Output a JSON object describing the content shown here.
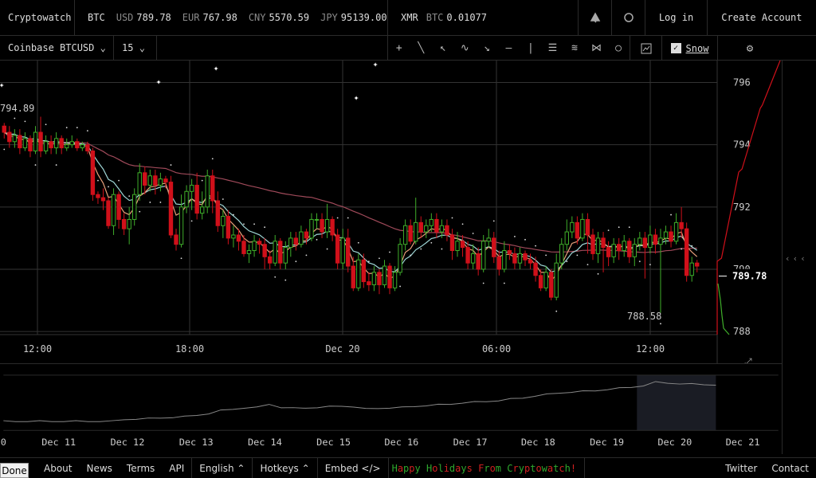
{
  "header": {
    "brand": "Cryptowatch",
    "quotes": [
      {
        "sym": "BTC",
        "pairs": [
          {
            "cur": "USD",
            "val": "789.78"
          },
          {
            "cur": "EUR",
            "val": "767.98"
          },
          {
            "cur": "CNY",
            "val": "5570.59"
          },
          {
            "cur": "JPY",
            "val": "95139.00"
          }
        ]
      }
    ],
    "xmr": {
      "sym": "XMR",
      "cur": "BTC",
      "val": "0.01077"
    },
    "alerts_icon": "alarm-icon",
    "theme_icon": "circle-icon",
    "login": "Log in",
    "create_account": "Create Account"
  },
  "toolbar": {
    "market": "Coinbase BTCUSD",
    "period": "15",
    "tools": [
      "+",
      "╲",
      "↖",
      "∿",
      "↘",
      "—",
      "|",
      "☰",
      "≋",
      "⋈",
      "○"
    ],
    "snow_label": "Snow",
    "snow_checked": true,
    "settings_icon": "gear-icon"
  },
  "chart_data": {
    "type": "candlestick",
    "market": "Coinbase BTCUSD",
    "interval": "15",
    "y_ticks": [
      788,
      790,
      792,
      794,
      796
    ],
    "ylim": [
      787.9,
      796.5
    ],
    "current_price": "789.78",
    "high_label": "794.89",
    "low_label": "788.58",
    "x_ticks": [
      "12:00",
      "18:00",
      "Dec 20",
      "06:00",
      "12:00"
    ],
    "candles": [
      [
        794.6,
        794.4,
        794.7,
        794.2
      ],
      [
        794.4,
        794.1,
        794.6,
        793.9
      ],
      [
        794.1,
        794.3,
        794.5,
        793.9
      ],
      [
        794.3,
        793.9,
        794.5,
        793.7
      ],
      [
        793.9,
        794.2,
        794.4,
        793.8
      ],
      [
        794.2,
        793.8,
        794.3,
        793.6
      ],
      [
        793.8,
        794.4,
        794.6,
        793.7
      ],
      [
        794.4,
        793.8,
        794.9,
        793.6
      ],
      [
        793.8,
        794.1,
        794.3,
        793.7
      ],
      [
        794.1,
        793.9,
        794.3,
        793.7
      ],
      [
        793.9,
        794.2,
        794.4,
        793.7
      ],
      [
        794.2,
        793.9,
        794.3,
        793.7
      ],
      [
        793.9,
        794.0,
        794.2,
        793.8
      ],
      [
        794.0,
        794.1,
        794.3,
        793.9
      ],
      [
        794.1,
        793.9,
        794.2,
        793.8
      ],
      [
        793.9,
        794.0,
        794.1,
        793.8
      ],
      [
        794.0,
        793.8,
        794.1,
        793.7
      ],
      [
        793.8,
        792.4,
        793.9,
        792.2
      ],
      [
        792.4,
        792.3,
        792.5,
        792.1
      ],
      [
        792.3,
        792.2,
        792.6,
        791.9
      ],
      [
        792.2,
        791.4,
        792.3,
        791.3
      ],
      [
        791.4,
        792.4,
        792.6,
        791.1
      ],
      [
        792.4,
        791.6,
        792.5,
        791.3
      ],
      [
        791.6,
        791.3,
        791.8,
        791.1
      ],
      [
        791.3,
        791.6,
        792.0,
        790.8
      ],
      [
        791.6,
        792.4,
        792.6,
        791.4
      ],
      [
        792.4,
        793.1,
        793.4,
        792.2
      ],
      [
        793.1,
        792.7,
        793.3,
        792.4
      ],
      [
        792.7,
        793.0,
        793.2,
        792.5
      ],
      [
        793.0,
        792.7,
        793.2,
        792.4
      ],
      [
        792.7,
        792.9,
        793.1,
        792.5
      ],
      [
        792.9,
        792.8,
        793.0,
        792.6
      ],
      [
        792.8,
        791.1,
        793.0,
        791.0
      ],
      [
        791.1,
        790.8,
        791.3,
        790.6
      ],
      [
        790.8,
        792.0,
        792.4,
        790.7
      ],
      [
        792.0,
        792.5,
        792.7,
        791.8
      ],
      [
        792.5,
        792.7,
        792.9,
        791.9
      ],
      [
        792.7,
        791.8,
        793.1,
        791.6
      ],
      [
        791.8,
        792.0,
        792.5,
        791.6
      ],
      [
        792.0,
        793.0,
        793.2,
        791.8
      ],
      [
        793.0,
        792.2,
        793.2,
        791.8
      ],
      [
        792.2,
        791.4,
        792.5,
        791.2
      ],
      [
        791.4,
        791.7,
        791.9,
        791.0
      ],
      [
        791.7,
        791.0,
        791.9,
        790.8
      ],
      [
        791.0,
        791.1,
        791.4,
        790.7
      ],
      [
        791.1,
        790.9,
        791.3,
        790.6
      ],
      [
        790.9,
        790.5,
        791.1,
        790.4
      ],
      [
        790.5,
        790.6,
        790.8,
        790.2
      ],
      [
        790.6,
        790.9,
        791.1,
        790.4
      ],
      [
        790.9,
        790.8,
        791.0,
        790.5
      ],
      [
        790.8,
        790.4,
        791.0,
        790.0
      ],
      [
        790.4,
        790.2,
        790.6,
        790.0
      ],
      [
        790.2,
        790.9,
        791.1,
        790.1
      ],
      [
        790.9,
        790.2,
        791.0,
        790.0
      ],
      [
        790.2,
        790.7,
        790.9,
        790.0
      ],
      [
        790.7,
        791.0,
        791.2,
        790.4
      ],
      [
        791.0,
        790.8,
        791.2,
        790.6
      ],
      [
        790.8,
        791.2,
        791.4,
        790.7
      ],
      [
        791.2,
        791.0,
        791.3,
        790.8
      ],
      [
        791.0,
        791.6,
        791.8,
        790.9
      ],
      [
        791.6,
        791.6,
        791.8,
        791.3
      ],
      [
        791.6,
        791.2,
        791.8,
        791.0
      ],
      [
        791.2,
        791.6,
        792.1,
        791.0
      ],
      [
        791.6,
        791.1,
        791.7,
        790.9
      ],
      [
        791.1,
        790.2,
        791.3,
        790.0
      ],
      [
        790.2,
        791.0,
        791.3,
        790.0
      ],
      [
        791.0,
        790.1,
        791.3,
        789.9
      ],
      [
        790.1,
        789.4,
        790.4,
        789.3
      ],
      [
        789.4,
        790.3,
        790.5,
        789.3
      ],
      [
        790.3,
        789.6,
        790.5,
        789.4
      ],
      [
        789.6,
        789.5,
        789.9,
        789.3
      ],
      [
        789.5,
        789.9,
        790.1,
        789.3
      ],
      [
        789.9,
        789.5,
        790.0,
        789.2
      ],
      [
        789.5,
        790.1,
        790.3,
        789.4
      ],
      [
        790.1,
        789.4,
        790.2,
        789.2
      ],
      [
        789.4,
        789.9,
        790.1,
        789.3
      ],
      [
        789.9,
        790.8,
        791.0,
        789.8
      ],
      [
        790.8,
        791.4,
        791.6,
        790.6
      ],
      [
        791.4,
        790.9,
        791.6,
        790.8
      ],
      [
        790.9,
        791.5,
        792.3,
        790.8
      ],
      [
        791.5,
        791.2,
        791.7,
        791.0
      ],
      [
        791.2,
        791.4,
        791.6,
        791.0
      ],
      [
        791.4,
        791.6,
        791.8,
        791.2
      ],
      [
        791.6,
        791.2,
        791.8,
        791.0
      ],
      [
        791.2,
        791.4,
        791.6,
        791.0
      ],
      [
        791.4,
        791.1,
        791.6,
        790.9
      ],
      [
        791.1,
        790.6,
        791.3,
        790.3
      ],
      [
        790.6,
        790.9,
        791.2,
        790.4
      ],
      [
        790.9,
        790.7,
        791.1,
        790.4
      ],
      [
        790.7,
        790.2,
        790.9,
        790.0
      ],
      [
        790.2,
        790.5,
        790.8,
        790.0
      ],
      [
        790.5,
        790.0,
        790.7,
        789.8
      ],
      [
        790.0,
        790.9,
        791.1,
        789.9
      ],
      [
        790.9,
        791.0,
        791.3,
        790.7
      ],
      [
        791.0,
        790.4,
        791.2,
        790.2
      ],
      [
        790.4,
        790.0,
        790.6,
        789.8
      ],
      [
        790.0,
        790.6,
        790.9,
        789.9
      ],
      [
        790.6,
        790.5,
        790.8,
        790.3
      ],
      [
        790.5,
        790.2,
        790.7,
        790.0
      ],
      [
        790.2,
        790.5,
        790.7,
        790.0
      ],
      [
        790.5,
        790.3,
        790.6,
        790.1
      ],
      [
        790.3,
        790.2,
        790.5,
        790.0
      ],
      [
        790.2,
        789.8,
        790.4,
        789.6
      ],
      [
        789.8,
        789.4,
        790.0,
        789.3
      ],
      [
        789.4,
        789.9,
        790.1,
        789.3
      ],
      [
        789.9,
        789.1,
        790.0,
        789.0
      ],
      [
        789.1,
        790.2,
        790.5,
        789.0
      ],
      [
        790.2,
        790.8,
        791.0,
        790.0
      ],
      [
        790.8,
        791.2,
        791.6,
        790.6
      ],
      [
        791.2,
        791.5,
        791.7,
        791.0
      ],
      [
        791.5,
        791.0,
        791.7,
        790.8
      ],
      [
        791.0,
        791.6,
        791.8,
        790.9
      ],
      [
        791.6,
        791.1,
        791.8,
        790.5
      ],
      [
        791.1,
        790.5,
        791.3,
        790.3
      ],
      [
        790.5,
        791.0,
        791.2,
        790.2
      ],
      [
        791.0,
        790.7,
        791.2,
        789.9
      ],
      [
        790.7,
        790.4,
        790.9,
        790.1
      ],
      [
        790.4,
        790.8,
        791.0,
        790.2
      ],
      [
        790.8,
        790.6,
        791.0,
        790.3
      ],
      [
        790.6,
        790.9,
        791.1,
        790.4
      ],
      [
        790.9,
        790.4,
        791.0,
        790.2
      ],
      [
        790.4,
        790.8,
        791.0,
        790.1
      ],
      [
        790.8,
        791.0,
        791.2,
        790.6
      ],
      [
        791.0,
        790.7,
        791.2,
        789.7
      ],
      [
        790.7,
        791.1,
        791.4,
        790.5
      ],
      [
        791.1,
        790.8,
        791.3,
        790.5
      ],
      [
        790.8,
        791.0,
        791.3,
        788.6
      ],
      [
        791.0,
        791.2,
        791.4,
        790.8
      ],
      [
        791.2,
        790.9,
        791.4,
        790.7
      ],
      [
        790.9,
        791.5,
        791.8,
        790.8
      ],
      [
        791.5,
        791.3,
        792.0,
        791.0
      ],
      [
        791.3,
        789.8,
        791.5,
        789.6
      ],
      [
        789.8,
        790.2,
        790.4,
        789.6
      ],
      [
        790.2,
        790.1,
        790.3,
        789.9
      ]
    ],
    "ema_fast_color": "#e8a07a",
    "ema_slow_color": "#9fd6d6",
    "sma_color": "#a04a5a",
    "up_color": "#3fae2a",
    "down_color": "#d0101a",
    "overview_dates": [
      "0",
      "Dec 11",
      "Dec 12",
      "Dec 13",
      "Dec 14",
      "Dec 15",
      "Dec 16",
      "Dec 17",
      "Dec 18",
      "Dec 19",
      "Dec 20",
      "Dec 21"
    ],
    "overview_values": [
      786,
      786,
      786,
      786,
      786,
      786,
      786,
      786,
      786,
      786,
      786.5,
      786.6,
      786.7,
      786.9,
      787,
      787.2,
      787.6,
      788,
      788.8,
      789.2,
      789.5,
      789.6,
      790.5,
      789.6,
      789.4,
      789.5,
      789.6,
      789.8,
      790,
      789.8,
      789.2,
      789.4,
      789.5,
      789.6,
      789.9,
      790.1,
      790.3,
      790.5,
      790.8,
      791.0,
      791.2,
      791.4,
      791.8,
      792.1,
      792.6,
      793.0,
      793.4,
      793.6,
      793.8,
      794.0,
      794.3,
      794.6,
      794.9,
      795.3,
      796.2,
      796.0,
      795.8,
      795.7,
      795.6,
      795.5
    ],
    "overview_highlight": "Dec 20"
  },
  "footer": {
    "done": "Done",
    "links": [
      "About",
      "News",
      "Terms",
      "API"
    ],
    "language": "English",
    "hotkeys": "Hotkeys",
    "embed": "Embed",
    "holiday": "Happy Holidays From Cryptowatch!",
    "twitter": "Twitter",
    "contact": "Contact"
  }
}
